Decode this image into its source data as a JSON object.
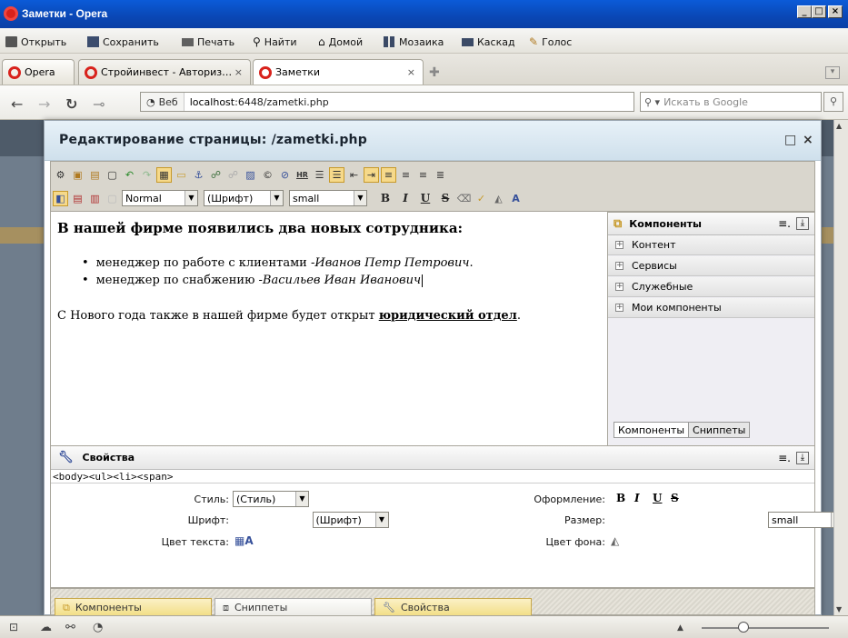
{
  "window": {
    "title": "Заметки - Opera"
  },
  "menubar": {
    "items": [
      {
        "label": "Открыть",
        "icon": "folder-icon"
      },
      {
        "label": "Сохранить",
        "icon": "save-icon"
      },
      {
        "label": "Печать",
        "icon": "print-icon"
      },
      {
        "label": "Найти",
        "icon": "search-icon"
      },
      {
        "label": "Домой",
        "icon": "home-icon"
      },
      {
        "label": "Мозаика",
        "icon": "tile-icon"
      },
      {
        "label": "Каскад",
        "icon": "cascade-icon"
      },
      {
        "label": "Голос",
        "icon": "voice-icon"
      }
    ]
  },
  "tabs": {
    "opera_menu": "Opera",
    "items": [
      {
        "label": "Стройинвест - Авториз…",
        "active": false
      },
      {
        "label": "Заметки",
        "active": true
      }
    ]
  },
  "address": {
    "web_label": "Веб",
    "url_host": "localhost",
    "url_rest": ":6448/zametki.php",
    "search_placeholder": "Искать в Google"
  },
  "dialog": {
    "title": "Редактирование страницы: /zametki.php",
    "format_select": "Normal",
    "font_select": "(Шрифт)",
    "size_select": "small"
  },
  "content": {
    "heading": "В нашей фирме появились два новых сотрудника:",
    "items": [
      {
        "prefix": "менеджер по работе с клиентами - ",
        "name": "Иванов Петр Петрович",
        "suffix": "."
      },
      {
        "prefix": "менеджер по снабжению - ",
        "name": "Васильев Иван Иванович",
        "suffix": ""
      }
    ],
    "para_text": "С Нового года также в нашей фирме будет открыт ",
    "para_link": "юридический отдел",
    "para_end": "."
  },
  "components": {
    "title": "Компоненты",
    "items": [
      "Контент",
      "Сервисы",
      "Служебные",
      "Мои компоненты"
    ],
    "tab_components": "Компоненты",
    "tab_snippets": "Сниппеты"
  },
  "properties": {
    "title": "Свойства",
    "path": "<body><ul><li><span>",
    "style_label": "Стиль:",
    "style_value": "(Стиль)",
    "font_label": "Шрифт:",
    "font_value": "(Шрифт)",
    "text_color_label": "Цвет текста:",
    "format_label": "Оформление:",
    "size_label": "Размер:",
    "size_value": "small",
    "bg_color_label": "Цвет фона:"
  },
  "bottom_tabs": [
    "Компоненты",
    "Сниппеты",
    "Свойства"
  ],
  "colors": {
    "titlebar": "#0a47b5",
    "accent_tab": "#f2dd84",
    "active_button": "#f6d98a"
  }
}
